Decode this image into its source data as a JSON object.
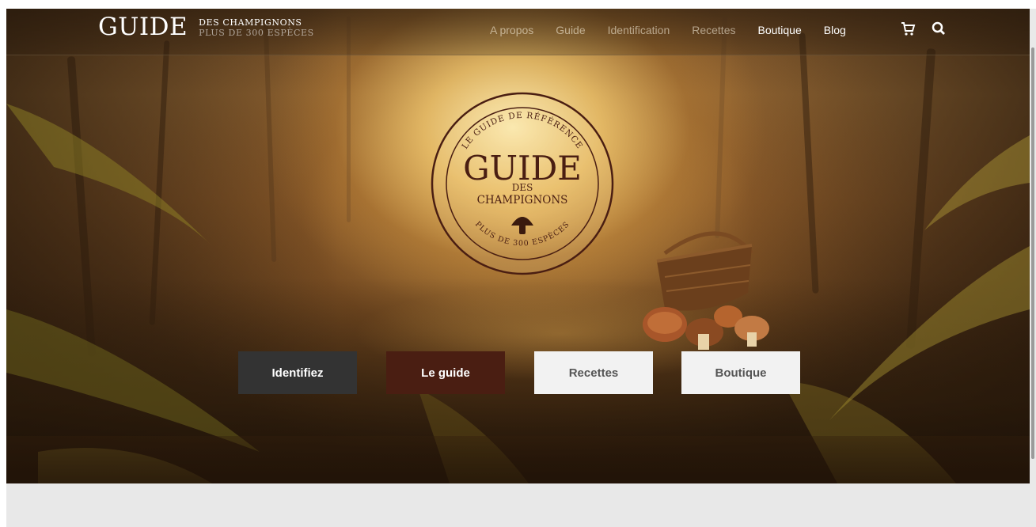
{
  "header": {
    "logo": {
      "main": "GUIDE",
      "line1": "DES CHAMPIGNONS",
      "line2": "PLUS DE 300 ESPÈCES"
    },
    "nav": [
      {
        "label": "A propos"
      },
      {
        "label": "Guide"
      },
      {
        "label": "Identification"
      },
      {
        "label": "Recettes"
      },
      {
        "label": "Boutique"
      },
      {
        "label": "Blog"
      }
    ],
    "icons": [
      "cart-icon",
      "search-icon"
    ]
  },
  "hero": {
    "emblem": {
      "arc_top": "LE GUIDE DE RÉFÉRENCE",
      "title": "GUIDE",
      "des": "DES",
      "champignons": "CHAMPIGNONS",
      "arc_bottom": "PLUS DE 300 ESPÈCES",
      "icon": "mushroom-icon"
    },
    "buttons": {
      "identify": "Identifiez",
      "guide": "Le guide",
      "recipes": "Recettes",
      "shop": "Boutique"
    }
  },
  "colors": {
    "brand_brown": "#4a1e12",
    "dark_button": "#333333",
    "light_button": "#f2f2f2",
    "light_button_text": "#555555",
    "below_fold": "#e8e8e8"
  }
}
